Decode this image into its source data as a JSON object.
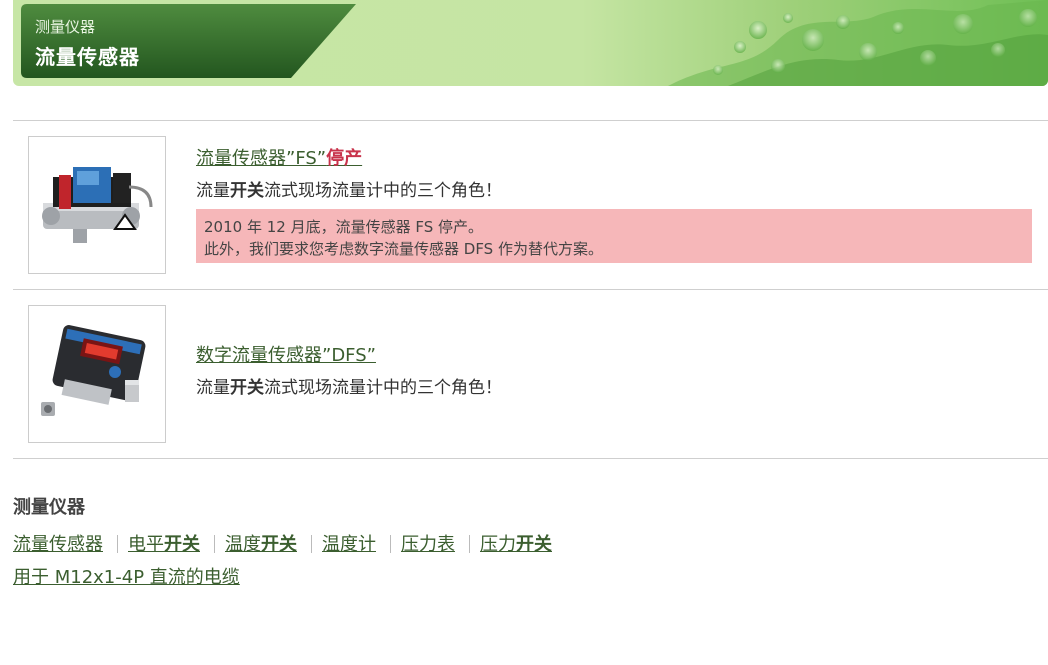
{
  "banner": {
    "category": "测量仪器",
    "title": "流量传感器"
  },
  "products": [
    {
      "title": "流量传感器”FS”",
      "discontinued_label": "停产",
      "desc_prefix": "流量",
      "desc_bold": "开关",
      "desc_suffix": "流式现场流量计中的三个角色！",
      "notice_line1": "2010 年 12 月底，流量传感器 FS 停产。",
      "notice_line2": "此外，我们要求您考虑数字流量传感器 DFS 作为替代方案。"
    },
    {
      "title": "数字流量传感器”DFS”",
      "desc_prefix": "流量",
      "desc_bold": "开关",
      "desc_suffix": "流式现场流量计中的三个角色！"
    }
  ],
  "section": {
    "title": "测量仪器",
    "links": [
      {
        "text": "流量传感器",
        "bold": ""
      },
      {
        "text": "电平",
        "bold": "开关"
      },
      {
        "text": "温度",
        "bold": "开关"
      },
      {
        "text": "温度计",
        "bold": ""
      },
      {
        "text": "压力表",
        "bold": ""
      },
      {
        "text": "压力",
        "bold": "开关"
      }
    ],
    "cable_link": "用于 M12x1-4P 直流的电缆"
  },
  "colors": {
    "banner_green": "#c7e6a6",
    "plate_green": "#2f6b2a",
    "link_green": "#3b5e2f",
    "discontinued_red": "#c8334b",
    "notice_pink": "#f6b7b9"
  }
}
